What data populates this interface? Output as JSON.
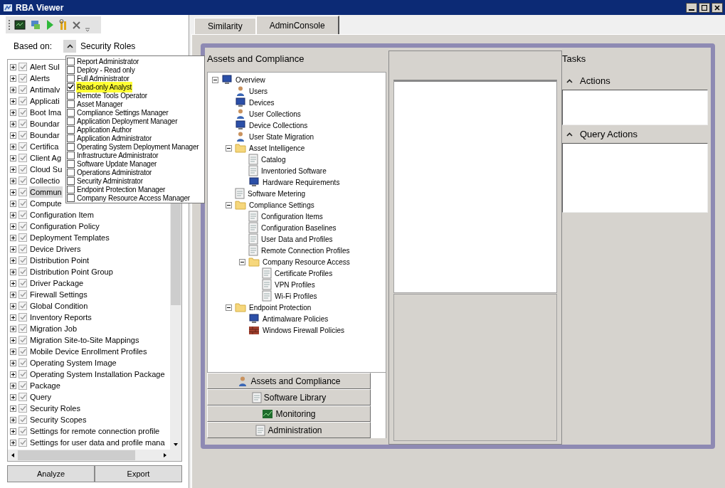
{
  "window": {
    "title": "RBA Viewer"
  },
  "based_on": {
    "label": "Based on:",
    "value": "Security Roles",
    "expanded": true
  },
  "role_options": [
    {
      "label": "Report Administrator",
      "checked": false,
      "selected": false
    },
    {
      "label": "Deploy - Read only",
      "checked": false,
      "selected": false
    },
    {
      "label": "Full Administrator",
      "checked": false,
      "selected": false
    },
    {
      "label": "Read-only Analyst",
      "checked": true,
      "selected": true
    },
    {
      "label": "Remote Tools Operator",
      "checked": false,
      "selected": false
    },
    {
      "label": "Asset Manager",
      "checked": false,
      "selected": false
    },
    {
      "label": "Compliance Settings Manager",
      "checked": false,
      "selected": false
    },
    {
      "label": "Application Deployment Manager",
      "checked": false,
      "selected": false
    },
    {
      "label": "Application Author",
      "checked": false,
      "selected": false
    },
    {
      "label": "Application Administrator",
      "checked": false,
      "selected": false
    },
    {
      "label": "Operating System Deployment Manager",
      "checked": false,
      "selected": false
    },
    {
      "label": "Infrastructure Administrator",
      "checked": false,
      "selected": false
    },
    {
      "label": "Software Update Manager",
      "checked": false,
      "selected": false
    },
    {
      "label": "Operations Administrator",
      "checked": false,
      "selected": false
    },
    {
      "label": "Security Administrator",
      "checked": false,
      "selected": false
    },
    {
      "label": "Endpoint Protection Manager",
      "checked": false,
      "selected": false
    },
    {
      "label": "Company Resource Access Manager",
      "checked": false,
      "selected": false
    }
  ],
  "permissions": [
    {
      "label": "Alert Sul",
      "checked": true,
      "expanded": false,
      "selected": false
    },
    {
      "label": "Alerts",
      "checked": true,
      "expanded": false,
      "selected": false
    },
    {
      "label": "Antimalv",
      "checked": true,
      "expanded": false,
      "selected": false
    },
    {
      "label": "Applicati",
      "checked": true,
      "expanded": false,
      "selected": false
    },
    {
      "label": "Boot Ima",
      "checked": true,
      "expanded": false,
      "selected": false
    },
    {
      "label": "Boundar",
      "checked": true,
      "expanded": false,
      "selected": false
    },
    {
      "label": "Boundar",
      "checked": true,
      "expanded": false,
      "selected": false
    },
    {
      "label": "Certifica",
      "checked": true,
      "expanded": false,
      "selected": false
    },
    {
      "label": "Client Ag",
      "checked": true,
      "expanded": false,
      "selected": false
    },
    {
      "label": "Cloud Su",
      "checked": true,
      "expanded": false,
      "selected": false
    },
    {
      "label": "Collectio",
      "checked": true,
      "expanded": false,
      "selected": false
    },
    {
      "label": "Commun",
      "checked": true,
      "expanded": false,
      "selected": true
    },
    {
      "label": "Compute",
      "checked": true,
      "expanded": false,
      "selected": false
    },
    {
      "label": "Configuration Item",
      "checked": true,
      "expanded": false,
      "selected": false
    },
    {
      "label": "Configuration Policy",
      "checked": true,
      "expanded": false,
      "selected": false
    },
    {
      "label": "Deployment Templates",
      "checked": true,
      "expanded": false,
      "selected": false
    },
    {
      "label": "Device Drivers",
      "checked": true,
      "expanded": false,
      "selected": false
    },
    {
      "label": "Distribution Point",
      "checked": true,
      "expanded": false,
      "selected": false
    },
    {
      "label": "Distribution Point Group",
      "checked": true,
      "expanded": false,
      "selected": false
    },
    {
      "label": "Driver Package",
      "checked": true,
      "expanded": false,
      "selected": false
    },
    {
      "label": "Firewall Settings",
      "checked": true,
      "expanded": false,
      "selected": false
    },
    {
      "label": "Global Condition",
      "checked": true,
      "expanded": false,
      "selected": false
    },
    {
      "label": "Inventory Reports",
      "checked": true,
      "expanded": false,
      "selected": false
    },
    {
      "label": "Migration Job",
      "checked": true,
      "expanded": false,
      "selected": false
    },
    {
      "label": "Migration Site-to-Site Mappings",
      "checked": true,
      "expanded": false,
      "selected": false
    },
    {
      "label": "Mobile Device Enrollment Profiles",
      "checked": true,
      "expanded": false,
      "selected": false
    },
    {
      "label": "Operating System Image",
      "checked": true,
      "expanded": false,
      "selected": false
    },
    {
      "label": "Operating System Installation Package",
      "checked": true,
      "expanded": false,
      "selected": false
    },
    {
      "label": "Package",
      "checked": true,
      "expanded": false,
      "selected": false
    },
    {
      "label": "Query",
      "checked": true,
      "expanded": false,
      "selected": false
    },
    {
      "label": "Security Roles",
      "checked": true,
      "expanded": false,
      "selected": false
    },
    {
      "label": "Security Scopes",
      "checked": true,
      "expanded": false,
      "selected": false
    },
    {
      "label": "Settings for remote connection profile",
      "checked": true,
      "expanded": false,
      "selected": false
    },
    {
      "label": "Settings for user data and profile mana",
      "checked": true,
      "expanded": false,
      "selected": false
    }
  ],
  "buttons": [
    "Analyze",
    "Export"
  ],
  "tabs": [
    {
      "label": "Similarity",
      "selected": false
    },
    {
      "label": "AdminConsole",
      "selected": true
    }
  ],
  "navigation": {
    "title": "Assets and Compliance",
    "tree": [
      {
        "label": "Overview",
        "kind": "monitor",
        "expanded": true,
        "children": [
          {
            "label": "Users",
            "kind": "person"
          },
          {
            "label": "Devices",
            "kind": "monitor"
          },
          {
            "label": "User Collections",
            "kind": "person"
          },
          {
            "label": "Device Collections",
            "kind": "monitor"
          },
          {
            "label": "User State Migration",
            "kind": "person"
          },
          {
            "label": "Asset Intelligence",
            "kind": "folder",
            "expanded": true,
            "children": [
              {
                "label": "Catalog",
                "kind": "document"
              },
              {
                "label": "Inventoried Software",
                "kind": "document"
              },
              {
                "label": "Hardware Requirements",
                "kind": "monitor"
              }
            ]
          },
          {
            "label": "Software Metering",
            "kind": "document"
          },
          {
            "label": "Compliance Settings",
            "kind": "folder",
            "expanded": true,
            "children": [
              {
                "label": "Configuration Items",
                "kind": "document"
              },
              {
                "label": "Configuration Baselines",
                "kind": "document"
              },
              {
                "label": "User Data and Profiles",
                "kind": "document"
              },
              {
                "label": "Remote Connection Profiles",
                "kind": "document"
              },
              {
                "label": "Company Resource Access",
                "kind": "folder",
                "expanded": true,
                "children": [
                  {
                    "label": "Certificate Profiles",
                    "kind": "document"
                  },
                  {
                    "label": "VPN Profiles",
                    "kind": "document"
                  },
                  {
                    "label": "Wi-Fi Profiles",
                    "kind": "document"
                  }
                ]
              }
            ]
          },
          {
            "label": "Endpoint Protection",
            "kind": "folder",
            "expanded": true,
            "children": [
              {
                "label": "Antimalware Policies",
                "kind": "monitor"
              },
              {
                "label": "Windows Firewall Policies",
                "kind": "brick"
              }
            ]
          }
        ]
      }
    ]
  },
  "workspaces": [
    {
      "label": "Assets and Compliance",
      "kind": "person"
    },
    {
      "label": "Software Library",
      "kind": "document"
    },
    {
      "label": "Monitoring",
      "kind": "chart"
    },
    {
      "label": "Administration",
      "kind": "document"
    }
  ],
  "tasks": {
    "title": "Tasks",
    "sections": [
      {
        "label": "Actions",
        "expanded": true
      },
      {
        "label": "Query Actions",
        "expanded": true
      }
    ]
  }
}
